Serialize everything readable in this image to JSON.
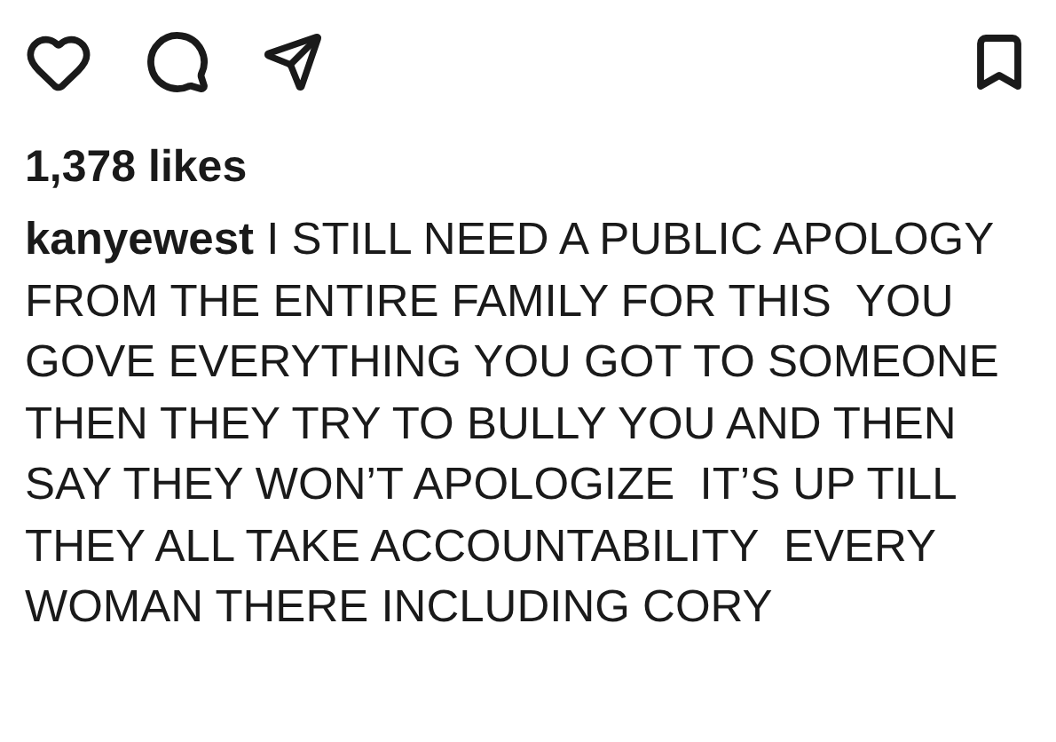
{
  "likes": "1,378 likes",
  "caption": "**kanyewest** I STILL NEED A PUBLIC APOLOGY FROM THE ENTIRE FAMILY FOR THIS  YOU GOVE EVERYTHING YOU GOT TO SOMEONE THEN THEY TRY TO BULLY YOU AND THEN SAY THEY WON’T APOLOGIZE  IT’S UP TILL THEY ALL TAKE ACCOUNTABILITY  EVERY WOMAN THERE INCLUDING CORY"
}
